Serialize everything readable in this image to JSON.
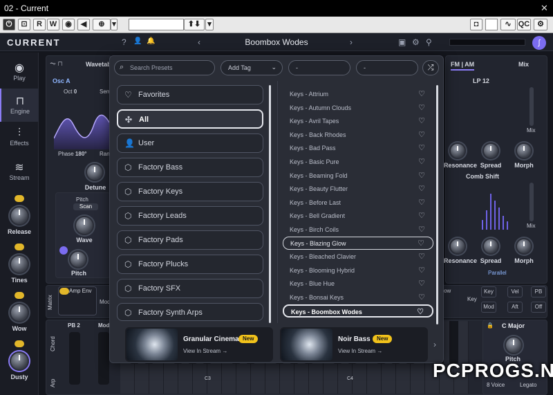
{
  "window": {
    "title": "02 - Current",
    "close": "✕"
  },
  "host": {
    "buttons": [
      "⏻",
      "⊡",
      "R",
      "W",
      "◉",
      "◀",
      "⊕",
      "▾"
    ],
    "qc": "QC",
    "arrows": "⬆⬇"
  },
  "plugin": {
    "logo": "CURRENT",
    "preset_name": "Boombox Wodes",
    "help": "?",
    "user": "👤",
    "bell": "🔔"
  },
  "sidebar": {
    "items": [
      {
        "label": "Play",
        "icon": "◉"
      },
      {
        "label": "Engine",
        "icon": "⊓"
      },
      {
        "label": "Effects",
        "icon": "⫶"
      },
      {
        "label": "Stream",
        "icon": "≋"
      }
    ],
    "knobs": [
      {
        "label": "Release"
      },
      {
        "label": "Tines"
      },
      {
        "label": "Wow"
      },
      {
        "label": "Dusty"
      }
    ]
  },
  "engine": {
    "wavetable": "Wavetab",
    "osc": "Osc A",
    "oct_label": "Oct",
    "oct_value": "0",
    "sem": "Sem",
    "phase_label": "Phase",
    "phase_value": "180°",
    "ran": "Ran",
    "detune": "Detune",
    "pitch_group": "Pitch",
    "scan": "Scan",
    "wave": "Wave",
    "pitch": "Pitch",
    "fm_am": "FM | AM",
    "mix_tab": "Mix",
    "filter": "LP 12",
    "mix": "Mix",
    "resonance": "Resonance",
    "spread": "Spread",
    "morph": "Morph",
    "comb": "Comb Shift",
    "parallel": "Parallel",
    "matrix": "Matrix",
    "mods": "Mods",
    "amp_env": "Amp Env",
    "ow": "ow",
    "key": "Key",
    "key_btn": "Key",
    "vel": "Vel",
    "pb": "PB",
    "mod": "Mod",
    "aft": "Aft",
    "off": "Off",
    "chord": "Chord",
    "arp": "Arp",
    "pb2_label": "PB",
    "pb2_value": "2",
    "modw": "Mod",
    "c3": "C3",
    "c4": "C4",
    "scale": "C Major",
    "pitch2": "Pitch",
    "voices": "8 Voice",
    "legato": "Legato"
  },
  "browser": {
    "search_placeholder": "Search Presets",
    "add_tag": "Add Tag",
    "filter2": "-",
    "filter3": "-",
    "categories": [
      {
        "label": "Favorites",
        "icon": "♡"
      },
      {
        "label": "All",
        "icon": "✣"
      },
      {
        "label": "User",
        "icon": "👤"
      },
      {
        "label": "Factory Bass",
        "icon": "⬡"
      },
      {
        "label": "Factory Keys",
        "icon": "⬡"
      },
      {
        "label": "Factory Leads",
        "icon": "⬡"
      },
      {
        "label": "Factory Pads",
        "icon": "⬡"
      },
      {
        "label": "Factory Plucks",
        "icon": "⬡"
      },
      {
        "label": "Factory SFX",
        "icon": "⬡"
      },
      {
        "label": "Factory Synth Arps",
        "icon": "⬡"
      }
    ],
    "presets": [
      "Keys - Attrium",
      "Keys - Autumn Clouds",
      "Keys - Avril Tapes",
      "Keys - Back Rhodes",
      "Keys - Bad Pass",
      "Keys - Basic Pure",
      "Keys - Beaming Fold",
      "Keys - Beauty Flutter",
      "Keys - Before Last",
      "Keys - Bell Gradient",
      "Keys - Birch Coils",
      "Keys - Blazing Glow",
      "Keys - Bleached Clavier",
      "Keys - Blooming Hybrid",
      "Keys - Blue Hue",
      "Keys - Bonsai Keys",
      "Keys - Boombox Wodes"
    ],
    "promos": [
      {
        "name": "Granular Cinema",
        "badge": "New",
        "link": "View In Stream →"
      },
      {
        "name": "Noir Bass",
        "badge": "New",
        "link": "View In Stream →"
      }
    ]
  },
  "watermark": "PCPROGS.NET"
}
